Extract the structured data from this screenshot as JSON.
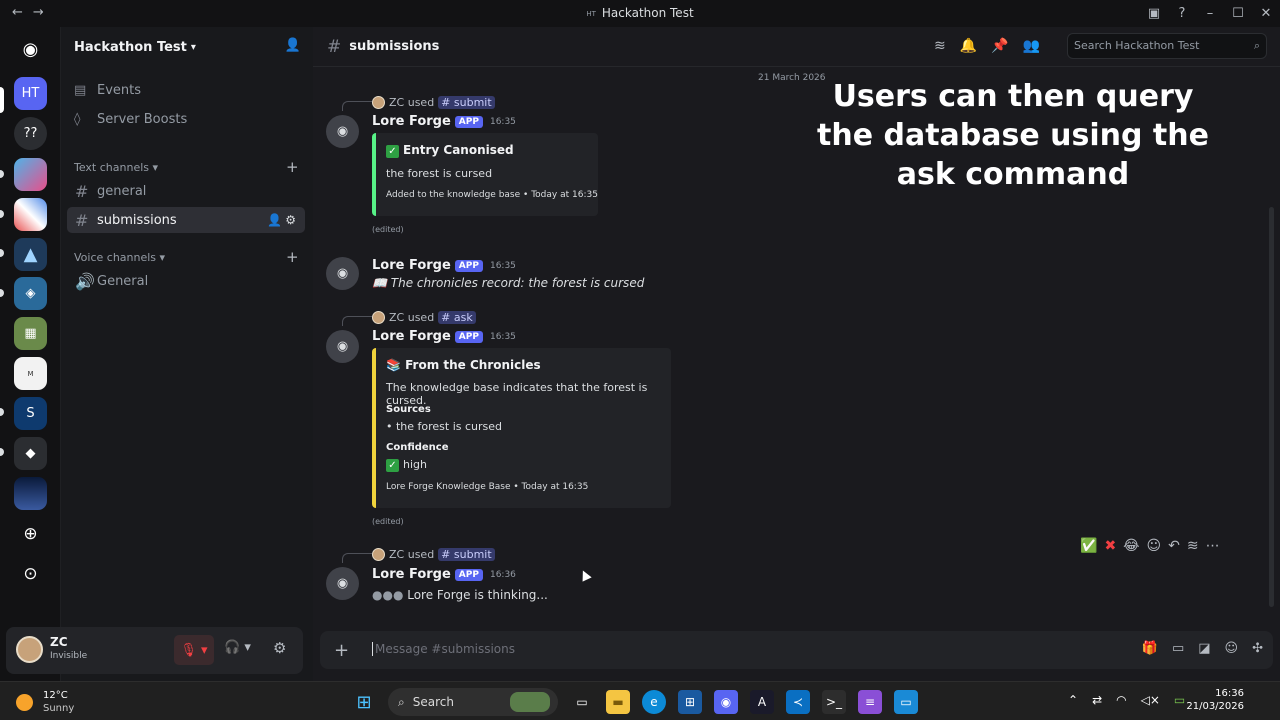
{
  "window": {
    "title": "Hackathon Test",
    "server_abbrev": "HT"
  },
  "server": {
    "name": "Hackathon Test",
    "events_label": "Events",
    "boosts_label": "Server Boosts",
    "text_category": "Text channels",
    "voice_category": "Voice channels",
    "text_channels": [
      "general",
      "submissions"
    ],
    "voice_channels": [
      "General"
    ],
    "icons": [
      {
        "label": "HT"
      },
      {
        "label": "??"
      }
    ]
  },
  "user": {
    "name": "ZC",
    "status": "Invisible"
  },
  "channel": {
    "name": "submissions",
    "search_placeholder": "Search Hackathon Test",
    "date": "21 March 2026",
    "composer_placeholder": "Message #submissions"
  },
  "overlay_caption": "Users can then query the database using the ask command",
  "messages": [
    {
      "reply_user": "ZC",
      "reply_verb": "used",
      "reply_cmd": "submit",
      "author": "Lore Forge",
      "badge": "APP",
      "time": "16:35",
      "embed_title": "Entry Canonised",
      "embed_desc": "the forest is cursed",
      "embed_footer": "Added to the knowledge base • Today at 16:35",
      "edited": "(edited)"
    },
    {
      "author": "Lore Forge",
      "badge": "APP",
      "time": "16:35",
      "text": "The chronicles record: the forest is cursed"
    },
    {
      "reply_user": "ZC",
      "reply_verb": "used",
      "reply_cmd": "ask",
      "author": "Lore Forge",
      "badge": "APP",
      "time": "16:35",
      "embed_title": "From the Chronicles",
      "embed_desc": "The knowledge base indicates that the forest is cursed.",
      "sources_label": "Sources",
      "sources_value": "• the forest is cursed",
      "confidence_label": "Confidence",
      "confidence_value": "high",
      "embed_footer": "Lore Forge Knowledge Base • Today at 16:35",
      "edited": "(edited)"
    },
    {
      "reply_user": "ZC",
      "reply_verb": "used",
      "reply_cmd": "submit",
      "author": "Lore Forge",
      "badge": "APP",
      "time": "16:36",
      "text": "Lore Forge is thinking..."
    }
  ],
  "taskbar": {
    "temp": "12°C",
    "weather": "Sunny",
    "search": "Search",
    "time": "16:36",
    "date": "21/03/2026"
  },
  "colors": {
    "accent": "#5865f2",
    "embed_green": "#57f287",
    "embed_yellow": "#f0d33c",
    "mic_red": "#f23f42"
  }
}
